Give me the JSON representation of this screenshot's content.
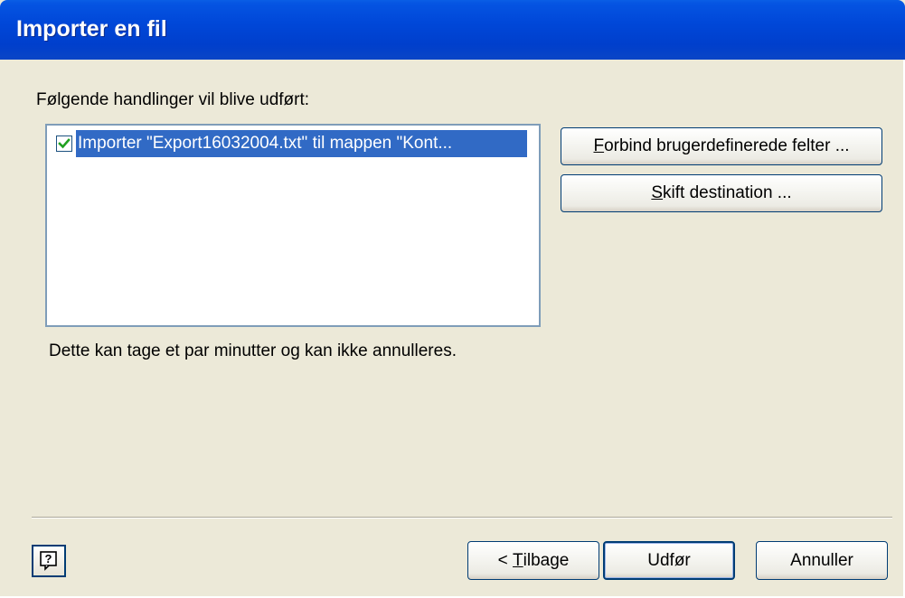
{
  "window": {
    "title": "Importer en fil"
  },
  "main": {
    "actions_label": "Følgende handlinger vil blive udført:",
    "actions": [
      {
        "checked": true,
        "label": "Importer \"Export16032004.txt\" til mappen \"Kont..."
      }
    ],
    "note": "Dette kan tage et par minutter og kan ikke annulleres."
  },
  "side_buttons": {
    "map_fields": {
      "mnemonic": "F",
      "rest": "orbind brugerdefinerede felter ..."
    },
    "change_destination": {
      "mnemonic": "S",
      "rest": "kift destination ..."
    }
  },
  "footer": {
    "help_icon": "help-question-icon",
    "back": {
      "prefix": "< ",
      "mnemonic": "T",
      "rest": "ilbage"
    },
    "finish": "Udfør",
    "cancel": "Annuller"
  },
  "colors": {
    "titlebar": "#0047d8",
    "dialog_bg": "#ece9d8",
    "selection": "#316ac5",
    "button_border": "#003c74"
  }
}
